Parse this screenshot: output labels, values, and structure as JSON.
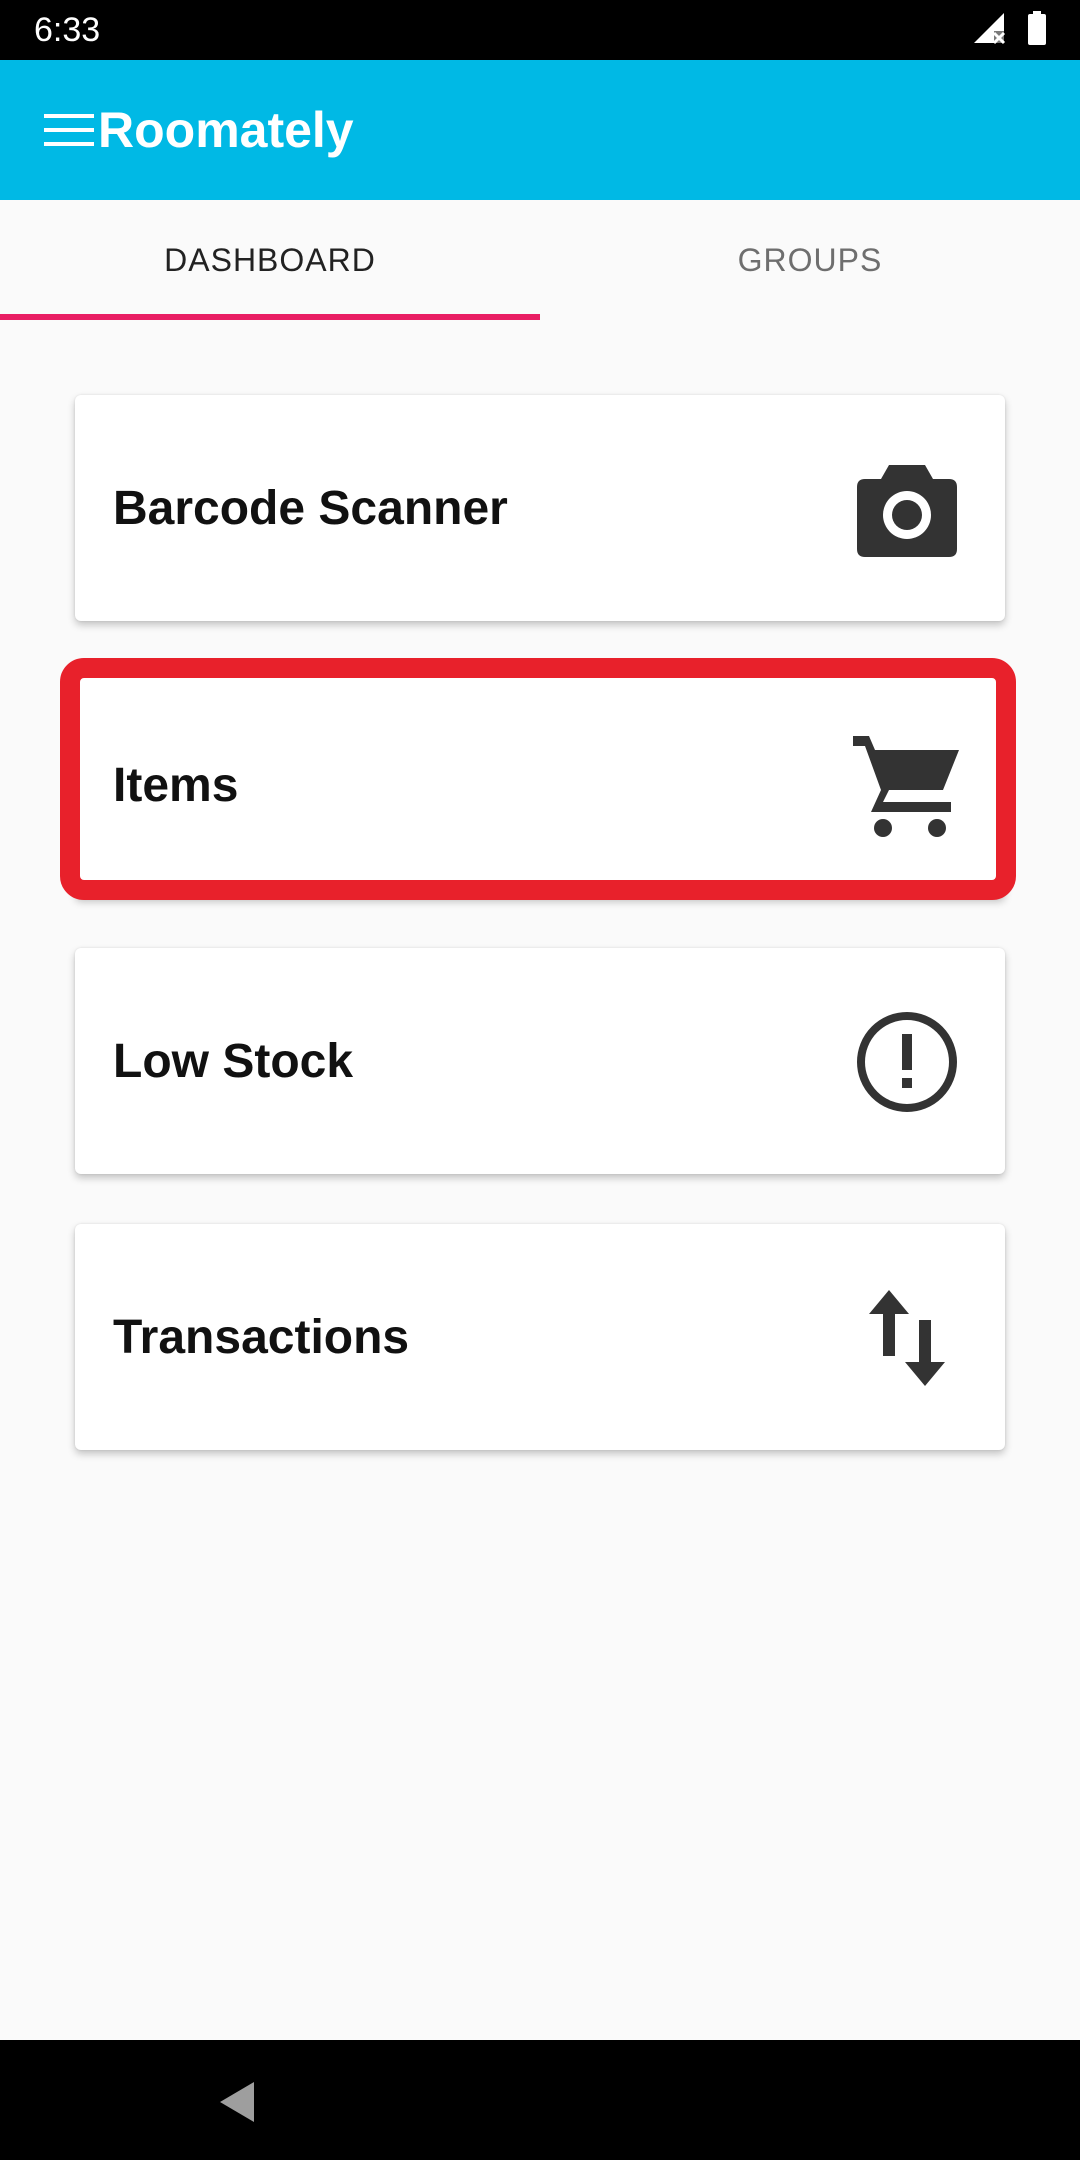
{
  "status_bar": {
    "time": "6:33",
    "signal_icon": "signal-no-service-icon",
    "battery_icon": "battery-full-icon"
  },
  "app_bar": {
    "title": "Roomately",
    "menu_icon": "hamburger-menu-icon",
    "color": "#00b9e5"
  },
  "tabs": [
    {
      "label": "DASHBOARD",
      "selected": true
    },
    {
      "label": "GROUPS",
      "selected": false
    }
  ],
  "tab_indicator_color": "#e91e63",
  "cards": [
    {
      "label": "Barcode Scanner",
      "icon": "camera-icon"
    },
    {
      "label": "Items",
      "icon": "shopping-cart-icon",
      "highlighted": true
    },
    {
      "label": "Low Stock",
      "icon": "alert-circle-icon"
    },
    {
      "label": "Transactions",
      "icon": "swap-vertical-icon"
    }
  ],
  "highlight_color": "#e8212b",
  "nav_bar": {
    "back_icon": "back-triangle-icon"
  }
}
